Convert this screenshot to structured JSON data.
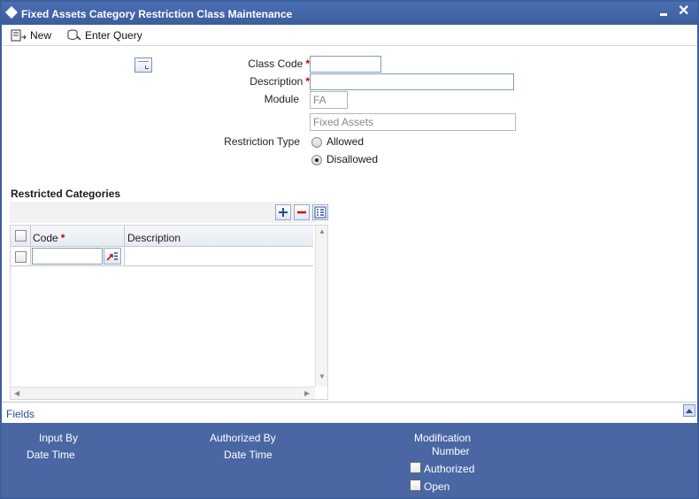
{
  "window": {
    "title": "Fixed Assets Category Restriction Class Maintenance",
    "close_glyph": "✕"
  },
  "toolbar": {
    "new_label": "New",
    "enter_query_label": "Enter Query"
  },
  "form": {
    "class_code": {
      "label": "Class Code",
      "required_mark": "*",
      "value": ""
    },
    "description": {
      "label": "Description",
      "required_mark": "*",
      "value": ""
    },
    "module": {
      "label": "Module",
      "code": "FA",
      "name": "Fixed Assets"
    },
    "restriction_type": {
      "label": "Restriction Type",
      "options": [
        "Allowed",
        "Disallowed"
      ],
      "selected": "Disallowed"
    }
  },
  "restricted_categories": {
    "title": "Restricted Categories",
    "columns": {
      "code": "Code",
      "code_required_mark": "*",
      "description": "Description"
    },
    "rows": [
      {
        "code": "",
        "description": ""
      }
    ]
  },
  "fields_bar": {
    "label": "Fields"
  },
  "audit": {
    "input_by": "Input By",
    "date_time_1": "Date Time",
    "authorized_by": "Authorized By",
    "date_time_2": "Date Time",
    "modification": "Modification",
    "number": "Number",
    "authorized": "Authorized",
    "open": "Open"
  },
  "colors": {
    "title_bar": "#3f5f9c",
    "audit_bg": "#4a67a4",
    "required": "#cc0000",
    "link": "#2450a0"
  },
  "icons": [
    "new-icon",
    "enter-query-icon",
    "form-icon",
    "add-row-icon",
    "delete-row-icon",
    "single-view-icon",
    "lov-icon",
    "collapse-icon"
  ]
}
